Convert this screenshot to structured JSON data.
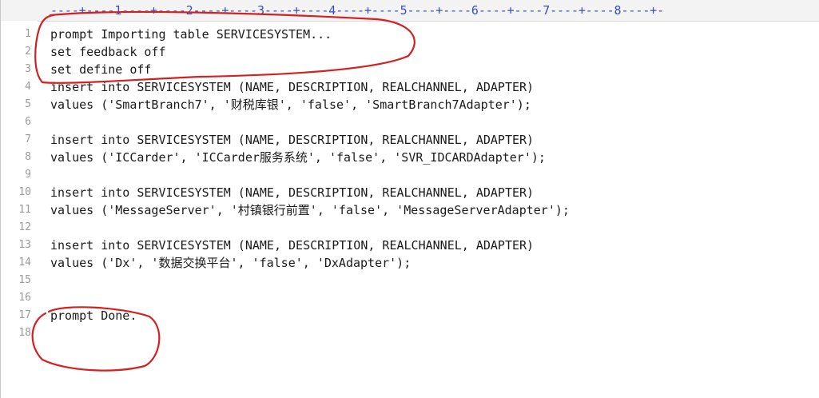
{
  "ruler": "----+----1----+----2----+----3----+----4----+----5----+----6----+----7----+----8----+-",
  "lines": [
    {
      "num": "1",
      "text": "prompt Importing table SERVICESYSTEM..."
    },
    {
      "num": "2",
      "text": "set feedback off"
    },
    {
      "num": "3",
      "text": "set define off"
    },
    {
      "num": "4",
      "text": "insert into SERVICESYSTEM (NAME, DESCRIPTION, REALCHANNEL, ADAPTER)"
    },
    {
      "num": "5",
      "text": "values ('SmartBranch7', '财税库银', 'false', 'SmartBranch7Adapter');"
    },
    {
      "num": "6",
      "text": ""
    },
    {
      "num": "7",
      "text": "insert into SERVICESYSTEM (NAME, DESCRIPTION, REALCHANNEL, ADAPTER)"
    },
    {
      "num": "8",
      "text": "values ('ICCarder', 'ICCarder服务系统', 'false', 'SVR_IDCARDAdapter');"
    },
    {
      "num": "9",
      "text": ""
    },
    {
      "num": "10",
      "text": "insert into SERVICESYSTEM (NAME, DESCRIPTION, REALCHANNEL, ADAPTER)"
    },
    {
      "num": "11",
      "text": "values ('MessageServer', '村镇银行前置', 'false', 'MessageServerAdapter');"
    },
    {
      "num": "12",
      "text": ""
    },
    {
      "num": "13",
      "text": "insert into SERVICESYSTEM (NAME, DESCRIPTION, REALCHANNEL, ADAPTER)"
    },
    {
      "num": "14",
      "text": "values ('Dx', '数据交换平台', 'false', 'DxAdapter');"
    },
    {
      "num": "15",
      "text": ""
    },
    {
      "num": "16",
      "text": ""
    },
    {
      "num": "17",
      "text": "prompt Done."
    },
    {
      "num": "18",
      "text": ""
    }
  ],
  "annotation_color": "#d42020"
}
